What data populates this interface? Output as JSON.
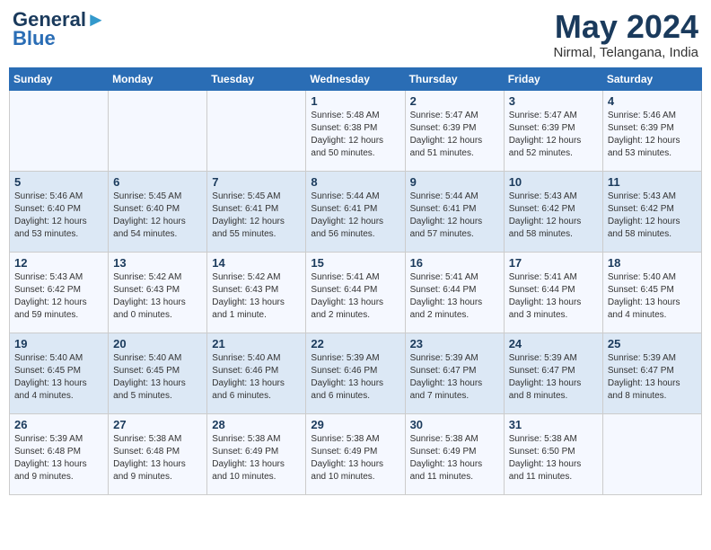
{
  "header": {
    "logo_line1": "General",
    "logo_line2": "Blue",
    "month_year": "May 2024",
    "location": "Nirmal, Telangana, India"
  },
  "weekdays": [
    "Sunday",
    "Monday",
    "Tuesday",
    "Wednesday",
    "Thursday",
    "Friday",
    "Saturday"
  ],
  "weeks": [
    [
      {
        "day": "",
        "info": ""
      },
      {
        "day": "",
        "info": ""
      },
      {
        "day": "",
        "info": ""
      },
      {
        "day": "1",
        "info": "Sunrise: 5:48 AM\nSunset: 6:38 PM\nDaylight: 12 hours\nand 50 minutes."
      },
      {
        "day": "2",
        "info": "Sunrise: 5:47 AM\nSunset: 6:39 PM\nDaylight: 12 hours\nand 51 minutes."
      },
      {
        "day": "3",
        "info": "Sunrise: 5:47 AM\nSunset: 6:39 PM\nDaylight: 12 hours\nand 52 minutes."
      },
      {
        "day": "4",
        "info": "Sunrise: 5:46 AM\nSunset: 6:39 PM\nDaylight: 12 hours\nand 53 minutes."
      }
    ],
    [
      {
        "day": "5",
        "info": "Sunrise: 5:46 AM\nSunset: 6:40 PM\nDaylight: 12 hours\nand 53 minutes."
      },
      {
        "day": "6",
        "info": "Sunrise: 5:45 AM\nSunset: 6:40 PM\nDaylight: 12 hours\nand 54 minutes."
      },
      {
        "day": "7",
        "info": "Sunrise: 5:45 AM\nSunset: 6:41 PM\nDaylight: 12 hours\nand 55 minutes."
      },
      {
        "day": "8",
        "info": "Sunrise: 5:44 AM\nSunset: 6:41 PM\nDaylight: 12 hours\nand 56 minutes."
      },
      {
        "day": "9",
        "info": "Sunrise: 5:44 AM\nSunset: 6:41 PM\nDaylight: 12 hours\nand 57 minutes."
      },
      {
        "day": "10",
        "info": "Sunrise: 5:43 AM\nSunset: 6:42 PM\nDaylight: 12 hours\nand 58 minutes."
      },
      {
        "day": "11",
        "info": "Sunrise: 5:43 AM\nSunset: 6:42 PM\nDaylight: 12 hours\nand 58 minutes."
      }
    ],
    [
      {
        "day": "12",
        "info": "Sunrise: 5:43 AM\nSunset: 6:42 PM\nDaylight: 12 hours\nand 59 minutes."
      },
      {
        "day": "13",
        "info": "Sunrise: 5:42 AM\nSunset: 6:43 PM\nDaylight: 13 hours\nand 0 minutes."
      },
      {
        "day": "14",
        "info": "Sunrise: 5:42 AM\nSunset: 6:43 PM\nDaylight: 13 hours\nand 1 minute."
      },
      {
        "day": "15",
        "info": "Sunrise: 5:41 AM\nSunset: 6:44 PM\nDaylight: 13 hours\nand 2 minutes."
      },
      {
        "day": "16",
        "info": "Sunrise: 5:41 AM\nSunset: 6:44 PM\nDaylight: 13 hours\nand 2 minutes."
      },
      {
        "day": "17",
        "info": "Sunrise: 5:41 AM\nSunset: 6:44 PM\nDaylight: 13 hours\nand 3 minutes."
      },
      {
        "day": "18",
        "info": "Sunrise: 5:40 AM\nSunset: 6:45 PM\nDaylight: 13 hours\nand 4 minutes."
      }
    ],
    [
      {
        "day": "19",
        "info": "Sunrise: 5:40 AM\nSunset: 6:45 PM\nDaylight: 13 hours\nand 4 minutes."
      },
      {
        "day": "20",
        "info": "Sunrise: 5:40 AM\nSunset: 6:45 PM\nDaylight: 13 hours\nand 5 minutes."
      },
      {
        "day": "21",
        "info": "Sunrise: 5:40 AM\nSunset: 6:46 PM\nDaylight: 13 hours\nand 6 minutes."
      },
      {
        "day": "22",
        "info": "Sunrise: 5:39 AM\nSunset: 6:46 PM\nDaylight: 13 hours\nand 6 minutes."
      },
      {
        "day": "23",
        "info": "Sunrise: 5:39 AM\nSunset: 6:47 PM\nDaylight: 13 hours\nand 7 minutes."
      },
      {
        "day": "24",
        "info": "Sunrise: 5:39 AM\nSunset: 6:47 PM\nDaylight: 13 hours\nand 8 minutes."
      },
      {
        "day": "25",
        "info": "Sunrise: 5:39 AM\nSunset: 6:47 PM\nDaylight: 13 hours\nand 8 minutes."
      }
    ],
    [
      {
        "day": "26",
        "info": "Sunrise: 5:39 AM\nSunset: 6:48 PM\nDaylight: 13 hours\nand 9 minutes."
      },
      {
        "day": "27",
        "info": "Sunrise: 5:38 AM\nSunset: 6:48 PM\nDaylight: 13 hours\nand 9 minutes."
      },
      {
        "day": "28",
        "info": "Sunrise: 5:38 AM\nSunset: 6:49 PM\nDaylight: 13 hours\nand 10 minutes."
      },
      {
        "day": "29",
        "info": "Sunrise: 5:38 AM\nSunset: 6:49 PM\nDaylight: 13 hours\nand 10 minutes."
      },
      {
        "day": "30",
        "info": "Sunrise: 5:38 AM\nSunset: 6:49 PM\nDaylight: 13 hours\nand 11 minutes."
      },
      {
        "day": "31",
        "info": "Sunrise: 5:38 AM\nSunset: 6:50 PM\nDaylight: 13 hours\nand 11 minutes."
      },
      {
        "day": "",
        "info": ""
      }
    ]
  ]
}
